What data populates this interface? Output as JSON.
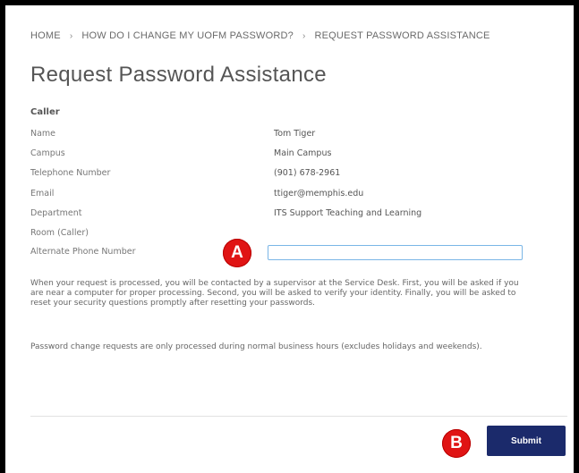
{
  "breadcrumb": {
    "items": [
      "HOME",
      "HOW DO I CHANGE MY UOFM PASSWORD?",
      "REQUEST PASSWORD ASSISTANCE"
    ],
    "separator": "›"
  },
  "page": {
    "title": "Request Password Assistance"
  },
  "caller": {
    "heading": "Caller",
    "fields": [
      {
        "label": "Name",
        "value": "Tom Tiger"
      },
      {
        "label": "Campus",
        "value": "Main Campus"
      },
      {
        "label": "Telephone Number",
        "value": "(901) 678-2961"
      },
      {
        "label": "Email",
        "value": "ttiger@memphis.edu"
      },
      {
        "label": "Department",
        "value": "ITS Support Teaching and Learning"
      },
      {
        "label": "Room (Caller)",
        "value": ""
      },
      {
        "label": "Alternate Phone Number",
        "value": ""
      }
    ]
  },
  "alternate_phone": {
    "value": "",
    "placeholder": ""
  },
  "notices": {
    "processing": "When your request is processed, you will be contacted by a supervisor at the Service Desk. First, you will be asked if you are near a computer for proper processing. Second, you will be asked to verify your identity. Finally, you will be asked to reset your security questions promptly after resetting your passwords.",
    "hours": "Password change requests are only processed during normal business hours (excludes holidays and weekends)."
  },
  "markers": {
    "a": "A",
    "b": "B"
  },
  "actions": {
    "submit_label": "Submit"
  },
  "colors": {
    "marker": "#e01414",
    "submit": "#1b2a6b",
    "input_border": "#7ab6e6"
  }
}
